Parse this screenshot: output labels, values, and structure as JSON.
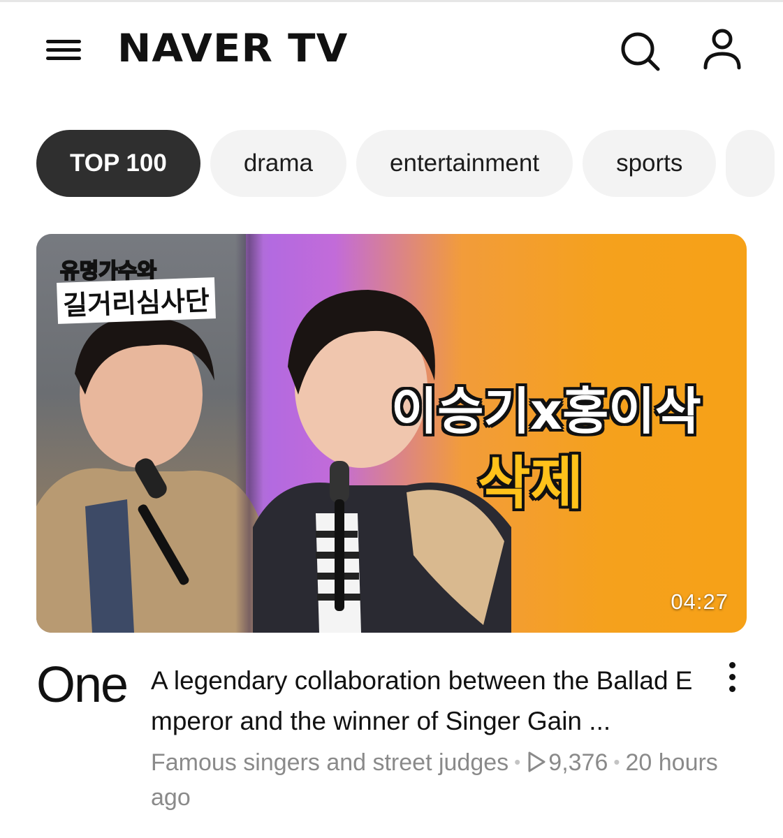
{
  "header": {
    "logo": "NAVER TV",
    "menu_icon": "hamburger-menu-icon",
    "search_icon": "search-icon",
    "user_icon": "user-icon"
  },
  "categories": [
    {
      "label": "TOP 100",
      "active": true
    },
    {
      "label": "drama",
      "active": false
    },
    {
      "label": "entertainment",
      "active": false
    },
    {
      "label": "sports",
      "active": false
    }
  ],
  "video": {
    "rank": "One",
    "thumbnail": {
      "show_logo_line1": "유명가수와",
      "show_logo_line2": "길거리심사단",
      "overlay_title": "이승기x홍이삭",
      "overlay_subtitle": "삭제",
      "duration": "04:27"
    },
    "title": "A legendary collaboration between the Ballad Emperor and the winner of Singer Gain ...",
    "channel": "Famous singers and street judges",
    "views": "9,376",
    "time": "20 hours ago"
  },
  "colors": {
    "chip_active_bg": "#2f2f2f",
    "chip_bg": "#f3f3f3",
    "meta_text": "#8a8a8a",
    "overlay_subtitle": "#ffc21a"
  }
}
